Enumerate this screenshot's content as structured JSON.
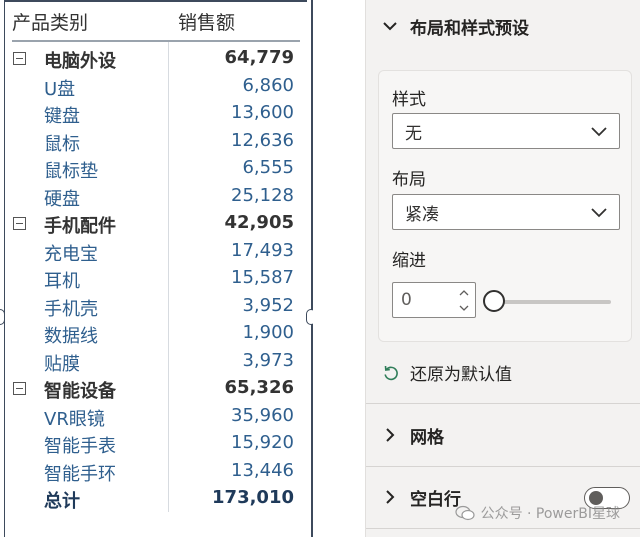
{
  "matrix": {
    "header": {
      "category": "产品类别",
      "sales": "销售额"
    },
    "rows": [
      {
        "type": "cat",
        "label": "电脑外设",
        "value": "64,779"
      },
      {
        "type": "item",
        "label": "U盘",
        "value": "6,860"
      },
      {
        "type": "item",
        "label": "键盘",
        "value": "13,600"
      },
      {
        "type": "item",
        "label": "鼠标",
        "value": "12,636"
      },
      {
        "type": "item",
        "label": "鼠标垫",
        "value": "6,555"
      },
      {
        "type": "item",
        "label": "硬盘",
        "value": "25,128"
      },
      {
        "type": "cat",
        "label": "手机配件",
        "value": "42,905"
      },
      {
        "type": "item",
        "label": "充电宝",
        "value": "17,493"
      },
      {
        "type": "item",
        "label": "耳机",
        "value": "15,587"
      },
      {
        "type": "item",
        "label": "手机壳",
        "value": "3,952"
      },
      {
        "type": "item",
        "label": "数据线",
        "value": "1,900"
      },
      {
        "type": "item",
        "label": "贴膜",
        "value": "3,973"
      },
      {
        "type": "cat",
        "label": "智能设备",
        "value": "65,326"
      },
      {
        "type": "item",
        "label": "VR眼镜",
        "value": "35,960"
      },
      {
        "type": "item",
        "label": "智能手表",
        "value": "15,920"
      },
      {
        "type": "item",
        "label": "智能手环",
        "value": "13,446"
      },
      {
        "type": "total",
        "label": "总计",
        "value": "173,010"
      }
    ]
  },
  "pane": {
    "layout_section": {
      "title": "布局和样式预设",
      "icon": "chevron-down-icon"
    },
    "style": {
      "label": "样式",
      "value": "无"
    },
    "layout": {
      "label": "布局",
      "value": "紧凑"
    },
    "indent": {
      "label": "缩进",
      "value": "0",
      "slider_fraction": 0
    },
    "reset_label": "还原为默认值",
    "grid_section": {
      "title": "网格",
      "icon": "chevron-right-icon"
    },
    "blank_section": {
      "title": "空白行",
      "icon": "chevron-right-icon",
      "toggle_on": false
    }
  },
  "watermark": "公众号 · PowerBI星球"
}
